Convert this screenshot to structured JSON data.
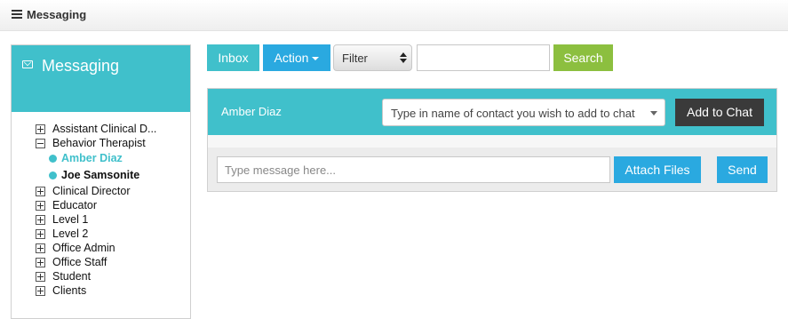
{
  "header": {
    "title": "Messaging"
  },
  "sidebar": {
    "title": "Messaging",
    "groups": [
      {
        "label": "Assistant Clinical D...",
        "expanded": false
      },
      {
        "label": "Behavior Therapist",
        "expanded": true,
        "children": [
          {
            "label": "Amber Diaz",
            "active": true
          },
          {
            "label": "Joe Samsonite",
            "active": false
          }
        ]
      },
      {
        "label": "Clinical Director",
        "expanded": false
      },
      {
        "label": "Educator",
        "expanded": false
      },
      {
        "label": "Level 1",
        "expanded": false
      },
      {
        "label": "Level 2",
        "expanded": false
      },
      {
        "label": "Office Admin",
        "expanded": false
      },
      {
        "label": "Office Staff",
        "expanded": false
      },
      {
        "label": "Student",
        "expanded": false
      },
      {
        "label": "Clients",
        "expanded": false
      }
    ]
  },
  "toolbar": {
    "inbox_label": "Inbox",
    "action_label": "Action",
    "filter_value": "Filter",
    "search_value": "",
    "search_label": "Search"
  },
  "chat": {
    "contact_name": "Amber Diaz",
    "add_contact_placeholder": "Type in name of contact you wish to add to chat",
    "add_to_chat_label": "Add to Chat",
    "message_placeholder": "Type message here...",
    "attach_label": "Attach Files",
    "send_label": "Send"
  },
  "colors": {
    "accent": "#40c0cb",
    "primary_button": "#2aa9e0",
    "search_button": "#8cbf3f",
    "dark_button": "#3a3a3a"
  },
  "icons": {
    "header": "menu-icon",
    "sidebar": "envelope-icon",
    "tree_collapsed": "plus-box-icon",
    "tree_expanded": "minus-box-icon",
    "contact": "status-dot-icon"
  }
}
